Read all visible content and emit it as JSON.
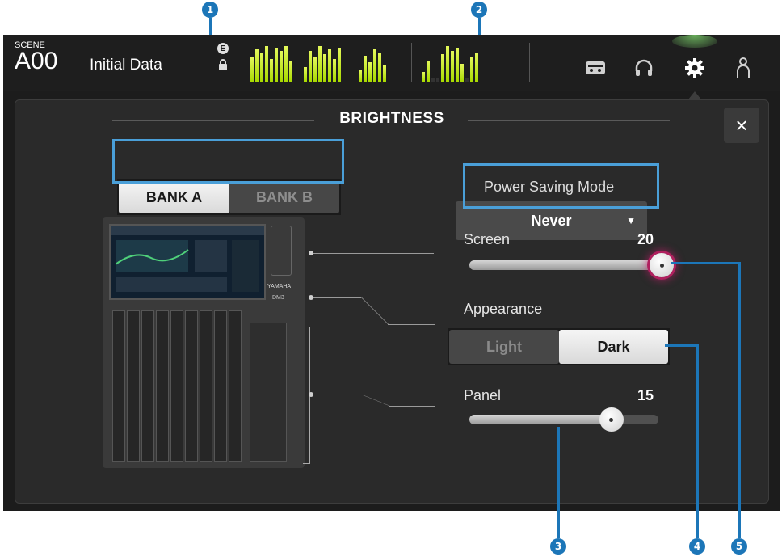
{
  "callouts": [
    "1",
    "2",
    "3",
    "4",
    "5"
  ],
  "topbar": {
    "scene_label": "SCENE",
    "scene_number": "A00",
    "scene_title": "Initial Data",
    "e_badge": "E",
    "icons": [
      "recorder-icon",
      "headphones-icon",
      "gear-icon",
      "user-icon"
    ]
  },
  "brightness": {
    "title": "BRIGHTNESS",
    "bank_a": "BANK A",
    "bank_b": "BANK B",
    "selected_bank": "BANK A",
    "power_saving_label": "Power Saving Mode",
    "power_saving_value": "Never",
    "screen_label": "Screen",
    "screen_value": "20",
    "screen_level": 1.0,
    "appearance_label": "Appearance",
    "appearance_light": "Light",
    "appearance_dark": "Dark",
    "appearance_selected": "Dark",
    "panel_label": "Panel",
    "panel_value": "15",
    "panel_level": 0.75,
    "close_label": "×"
  },
  "colors": {
    "callout": "#1c76b8",
    "highlight": "#4a9fd8",
    "meter": "#b7e82e",
    "meter_peak": "#ff6a2a",
    "active_glow": "#c0206a"
  },
  "mixer": {
    "logo_text": "YAMAHA",
    "model": "DM3"
  }
}
